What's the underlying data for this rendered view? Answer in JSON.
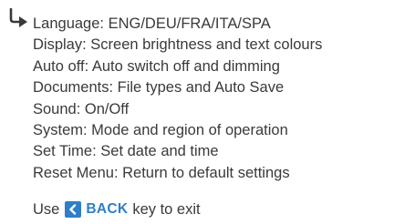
{
  "icons": {
    "pointer": "arrow-right-hooked-icon",
    "back": "chevron-left-icon"
  },
  "colors": {
    "text": "#3a3a3a",
    "accent": "#2e7fc8"
  },
  "menu": {
    "items": [
      {
        "text": "Language: ENG/DEU/FRA/ITA/SPA"
      },
      {
        "text": "Display: Screen brightness and text colours"
      },
      {
        "text": "Auto off: Auto switch off and dimming"
      },
      {
        "text": "Documents: File types and Auto Save"
      },
      {
        "text": "Sound: On/Off"
      },
      {
        "text": "System: Mode and region of operation"
      },
      {
        "text": "Set Time: Set date and time"
      },
      {
        "text": "Reset Menu: Return to default settings"
      }
    ]
  },
  "exit": {
    "prefix": "Use",
    "key_label": "BACK",
    "suffix": "key to exit"
  }
}
